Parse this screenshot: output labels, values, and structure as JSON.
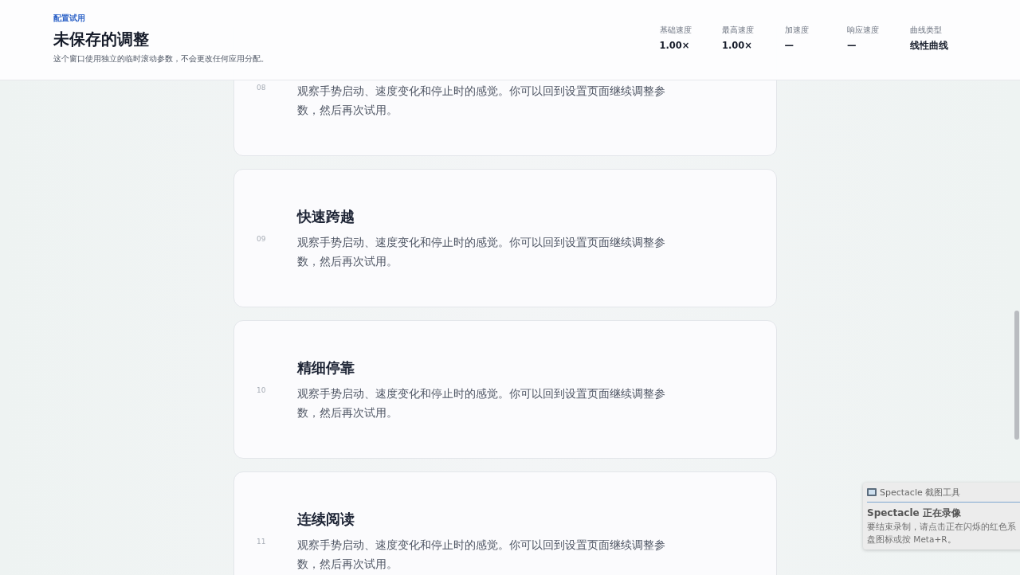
{
  "header": {
    "eyebrow": "配置试用",
    "title": "未保存的调整",
    "description": "这个窗口使用独立的临时滚动参数，不会更改任何应用分配。",
    "stats": [
      {
        "label": "基础速度",
        "value": "1.00×"
      },
      {
        "label": "最高速度",
        "value": "1.00×"
      },
      {
        "label": "加速度",
        "value": "—"
      },
      {
        "label": "响应速度",
        "value": "—"
      },
      {
        "label": "曲线类型",
        "value": "线性曲线"
      }
    ]
  },
  "cards": [
    {
      "number": "08",
      "body": "观察手势启动、速度变化和停止时的感觉。你可以回到设置页面继续调整参数，然后再次试用。"
    },
    {
      "number": "09",
      "title": "快速跨越",
      "body": "观察手势启动、速度变化和停止时的感觉。你可以回到设置页面继续调整参数，然后再次试用。"
    },
    {
      "number": "10",
      "title": "精细停靠",
      "body": "观察手势启动、速度变化和停止时的感觉。你可以回到设置页面继续调整参数，然后再次试用。"
    },
    {
      "number": "11",
      "title": "连续阅读",
      "body": "观察手势启动、速度变化和停止时的感觉。你可以回到设置页面继续调整参数，然后再次试用。"
    }
  ],
  "notification": {
    "app": "Spectacle 截图工具",
    "title": "Spectacle 正在录像",
    "lines": [
      "要结束录制，请点击正在闪烁的红色系",
      "盘图标或按 Meta+R。"
    ]
  }
}
